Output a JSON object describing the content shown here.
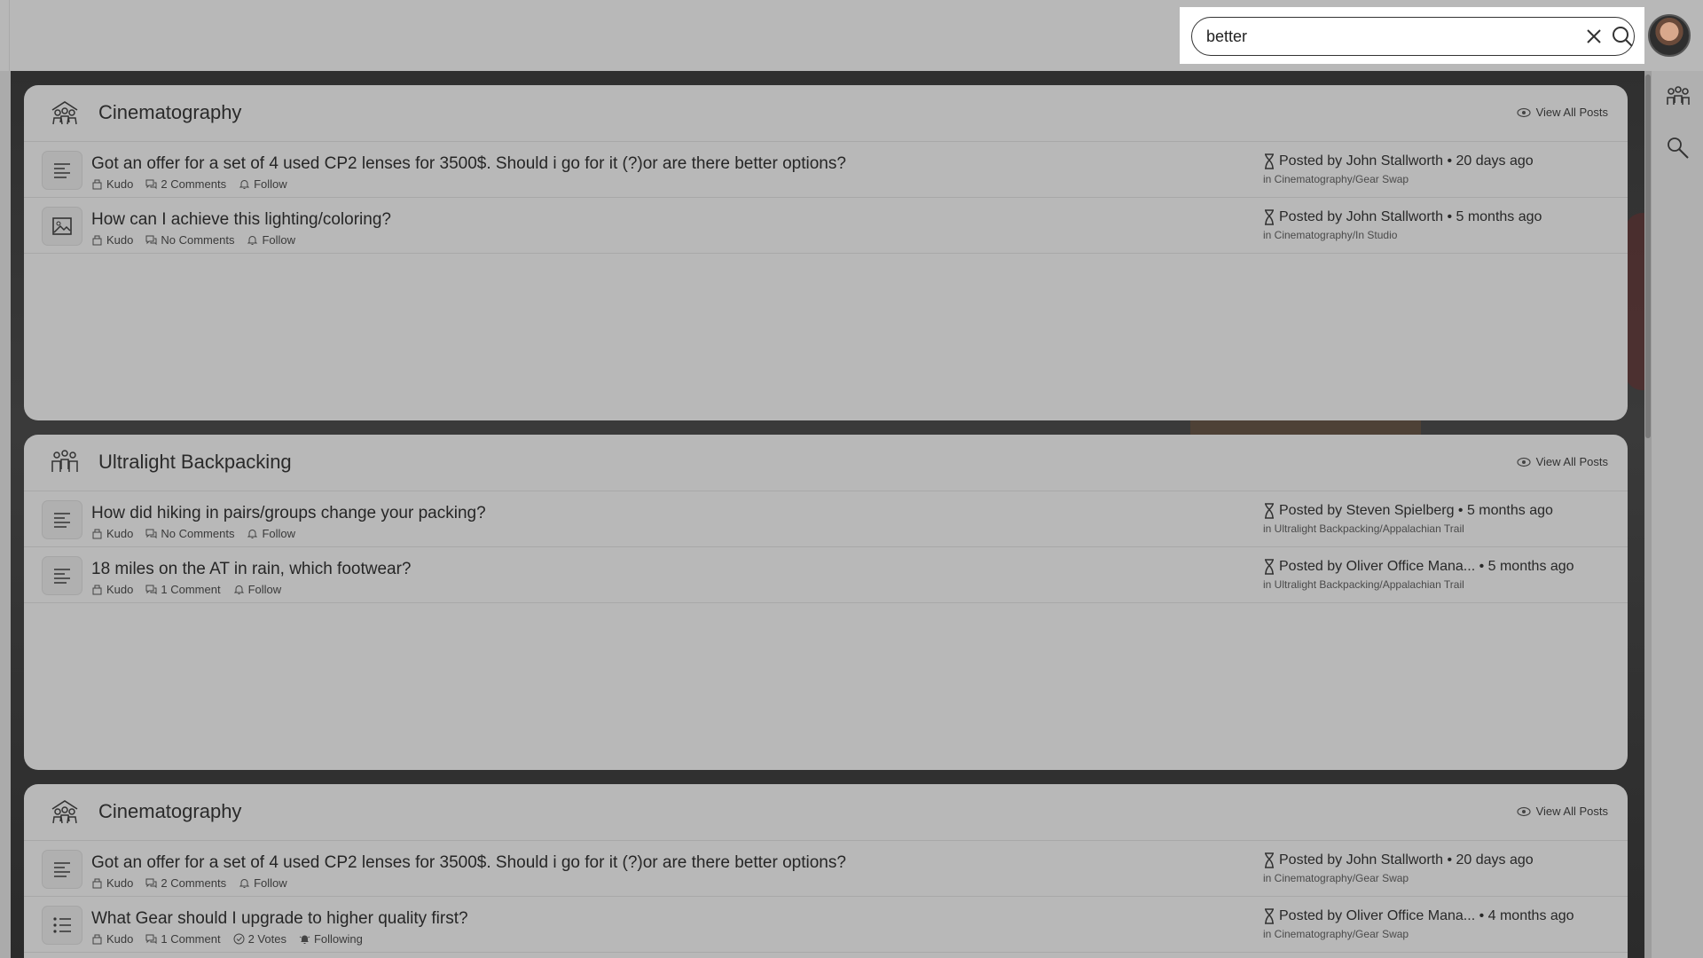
{
  "search": {
    "value": "better"
  },
  "rail": {
    "icons": [
      "groups-icon",
      "search-icon"
    ]
  },
  "cards": [
    {
      "title": "Cinematography",
      "view_all": "View All Posts",
      "posts": [
        {
          "type": "text",
          "title": "Got an offer for a set of 4 used CP2 lenses for 3500$. Should i go for it (?)or are there better options?",
          "kudo": "Kudo",
          "comments": "2 Comments",
          "follow": "Follow",
          "byline": "Posted by John Stallworth • 20 days ago",
          "where": "in Cinematography/Gear Swap"
        },
        {
          "type": "image",
          "title": "How can I achieve this lighting/coloring?",
          "kudo": "Kudo",
          "comments": "No Comments",
          "follow": "Follow",
          "byline": "Posted by John Stallworth • 5 months ago",
          "where": "in Cinematography/In Studio"
        }
      ]
    },
    {
      "title": "Ultralight Backpacking",
      "view_all": "View All Posts",
      "posts": [
        {
          "type": "text",
          "title": "How did hiking in pairs/groups change your packing?",
          "kudo": "Kudo",
          "comments": "No Comments",
          "follow": "Follow",
          "byline": "Posted by Steven Spielberg • 5 months ago",
          "where": "in Ultralight Backpacking/Appalachian Trail"
        },
        {
          "type": "text",
          "title": "18 miles on the AT in rain, which footwear?",
          "kudo": "Kudo",
          "comments": "1 Comment",
          "follow": "Follow",
          "byline": "Posted by Oliver Office Mana...  • 5 months ago",
          "where": "in Ultralight Backpacking/Appalachian Trail"
        }
      ]
    },
    {
      "title": "Cinematography",
      "view_all": "View All Posts",
      "posts": [
        {
          "type": "text",
          "title": "Got an offer for a set of 4 used CP2 lenses for 3500$. Should i go for it (?)or are there better options?",
          "kudo": "Kudo",
          "comments": "2 Comments",
          "follow": "Follow",
          "byline": "Posted by John Stallworth • 20 days ago",
          "where": "in Cinematography/Gear Swap"
        },
        {
          "type": "list",
          "title": "What Gear should I upgrade to higher quality first?",
          "kudo": "Kudo",
          "comments": "1 Comment",
          "votes": "2 Votes",
          "follow": "Following",
          "byline": "Posted by Oliver Office Mana...  • 4 months ago",
          "where": "in Cinematography/Gear Swap"
        }
      ]
    }
  ]
}
